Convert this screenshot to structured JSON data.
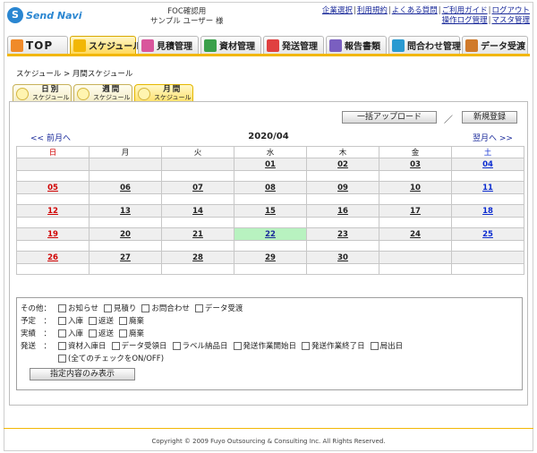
{
  "header": {
    "logo_mark": "S",
    "logo_text": "Send Navi",
    "user_line1": "FOC確認用",
    "user_line2": "サンプル ユーザー 様",
    "links_row1": [
      "企業選択",
      "利用規約",
      "よくある質問",
      "ご利用ガイド",
      "ログアウト"
    ],
    "links_row2": [
      "操作ログ管理",
      "マスタ管理"
    ]
  },
  "tabs": [
    {
      "label": "TOP",
      "icon_color": "#f08a2a",
      "icon": "house-icon"
    },
    {
      "label": "スケジュール",
      "icon_color": "#f2b705",
      "icon": "calendar-icon"
    },
    {
      "label": "見積管理",
      "icon_color": "#d9559c",
      "icon": "estimate-icon"
    },
    {
      "label": "資材管理",
      "icon_color": "#3aa04a",
      "icon": "material-icon"
    },
    {
      "label": "発送管理",
      "icon_color": "#e04040",
      "icon": "truck-icon"
    },
    {
      "label": "報告書類",
      "icon_color": "#7a5fc0",
      "icon": "document-icon"
    },
    {
      "label": "問合わせ管理",
      "icon_color": "#2a9ad1",
      "icon": "inquiry-icon"
    },
    {
      "label": "データ受渡",
      "icon_color": "#d07a2a",
      "icon": "data-icon"
    }
  ],
  "breadcrumb": "スケジュール > 月間スケジュール",
  "subtabs": [
    {
      "label": "日別",
      "sub": "スケジュール"
    },
    {
      "label": "週間",
      "sub": "スケジュール"
    },
    {
      "label": "月間",
      "sub": "スケジュール"
    }
  ],
  "buttons": {
    "bulk_upload": "一括アップロード",
    "slash": "／",
    "new_register": "新規登録"
  },
  "calendar": {
    "prev": "<< 前月へ",
    "next": "翌月へ >>",
    "title": "2020/04",
    "weekdays": [
      "日",
      "月",
      "火",
      "水",
      "木",
      "金",
      "土"
    ],
    "weeks": [
      [
        "",
        "",
        "",
        "01",
        "02",
        "03",
        "04"
      ],
      [
        "05",
        "06",
        "07",
        "08",
        "09",
        "10",
        "11"
      ],
      [
        "12",
        "13",
        "14",
        "15",
        "16",
        "17",
        "18"
      ],
      [
        "19",
        "20",
        "21",
        "22",
        "23",
        "24",
        "25"
      ],
      [
        "26",
        "27",
        "28",
        "29",
        "30",
        "",
        ""
      ]
    ],
    "today": "22"
  },
  "filter": {
    "rows": [
      {
        "label": "その他：",
        "items": [
          "お知らせ",
          "見積り",
          "お問合わせ",
          "データ受渡"
        ]
      },
      {
        "label": "予定　：",
        "items": [
          "入庫",
          "返送",
          "廃棄"
        ]
      },
      {
        "label": "実績　：",
        "items": [
          "入庫",
          "返送",
          "廃棄"
        ]
      },
      {
        "label": "発送　：",
        "items": [
          "資材入庫日",
          "データ受領日",
          "ラベル納品日",
          "発送作業開始日",
          "発送作業終了日",
          "局出日"
        ]
      }
    ],
    "all_toggle": "(全てのチェックをON/OFF)",
    "show_button": "指定内容のみ表示"
  },
  "footer": "Copyright © 2009 Fuyo Outsourcing & Consulting Inc. All Rights Reserved."
}
